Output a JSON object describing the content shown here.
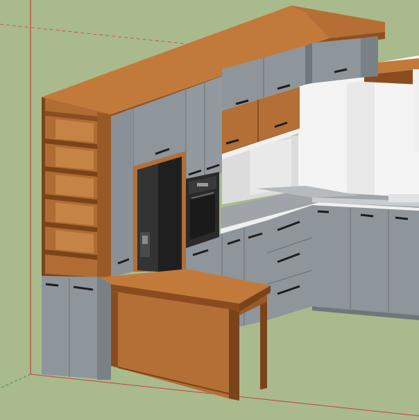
{
  "canvas": {
    "background": "#a9ba8c",
    "description_visible_text": ""
  },
  "colors": {
    "wood_light": "#c27a3a",
    "wood_mid": "#a9642b",
    "wood_dark": "#7a441b",
    "concrete": "#8e959b",
    "concrete_light": "#aab0b5",
    "concrete_dark": "#6f767c",
    "wall_white": "#f4f4f4",
    "wall_shade": "#dcdcdc",
    "appliance_black": "#222222",
    "handle": "#1c1c1c",
    "axis_red": "#c8403a",
    "axis_green": "#3f8f3f",
    "axis_blue": "#3a4fc8"
  },
  "model": {
    "name": "kitchen-3d-model",
    "parts": [
      "pantry-open-shelving",
      "tall-concrete-cabinets",
      "refrigerator-niche",
      "built-in-oven",
      "upper-wall-cabinets",
      "wood-glass-cabinets",
      "countertop",
      "base-drawers",
      "wood-breakfast-bar",
      "wood-soffit-top"
    ]
  },
  "axes": {
    "x_color": "red",
    "y_color": "green",
    "z_color": "blue"
  }
}
